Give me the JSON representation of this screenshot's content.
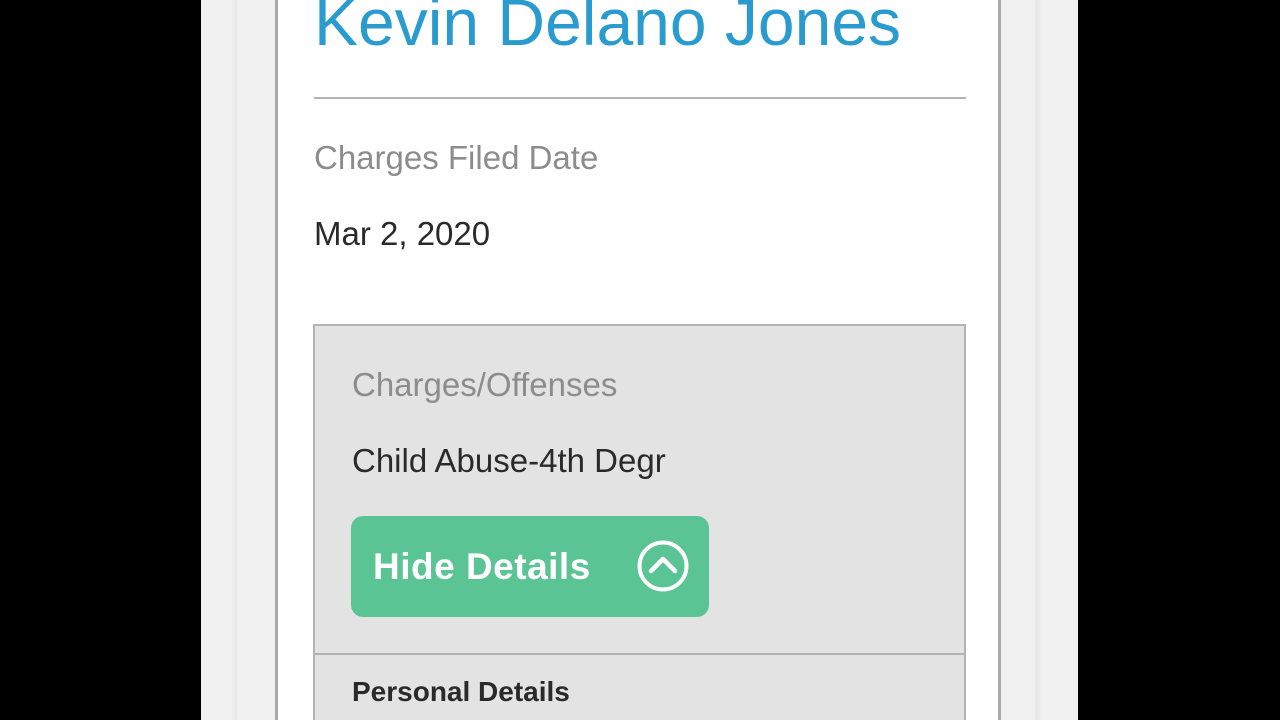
{
  "record": {
    "name": "Kevin Delano Jones",
    "charges_filed_label": "Charges Filed Date",
    "charges_filed_value": "Mar 2, 2020"
  },
  "charges": {
    "label": "Charges/Offenses",
    "value": "Child Abuse-4th Degr",
    "toggle_button": {
      "label": "Hide Details",
      "icon": "chevron-up-circle-icon"
    }
  },
  "personal_details": {
    "heading": "Personal Details"
  },
  "colors": {
    "name_blue": "#2a9bcf",
    "button_green": "#5ac494",
    "panel_gray": "#e3e3e3",
    "label_gray": "#8c8c8c"
  }
}
